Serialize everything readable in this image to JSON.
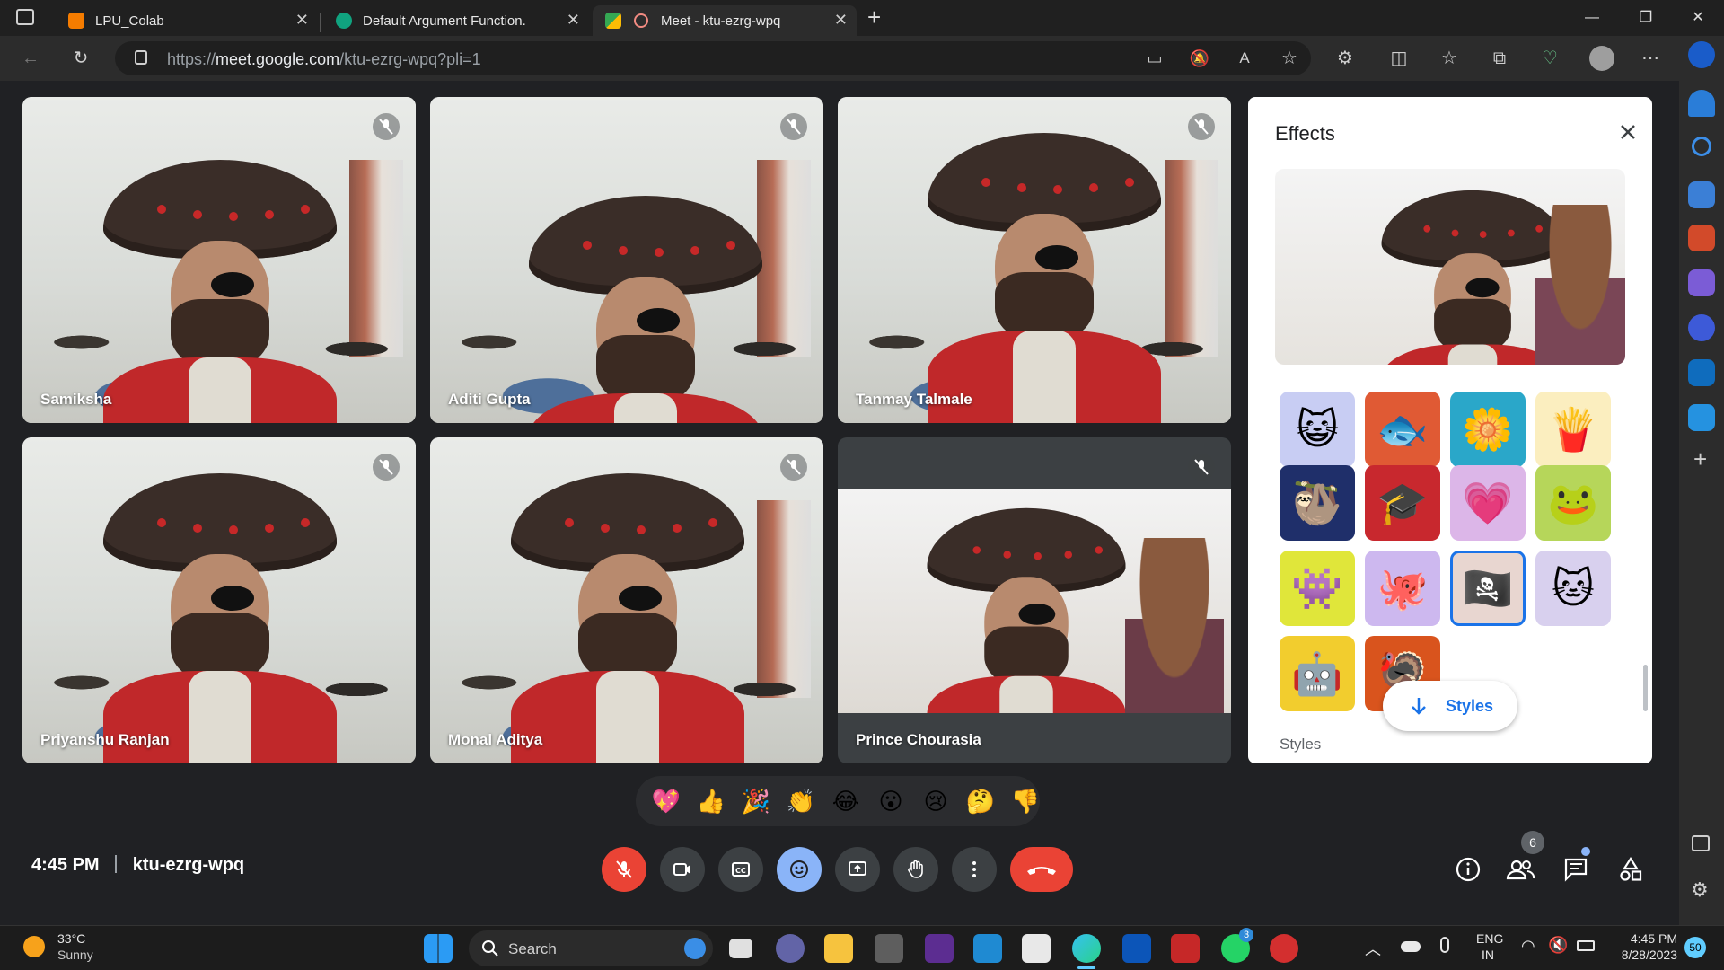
{
  "browser": {
    "tabs": [
      {
        "title": "LPU_Colab",
        "active": false
      },
      {
        "title": "Default Argument Function.",
        "active": false
      },
      {
        "title": "Meet - ktu-ezrg-wpq",
        "active": true
      }
    ],
    "url_prefix": "https://",
    "url_host": "meet.google.com",
    "url_path": "/ktu-ezrg-wpq?pli=1"
  },
  "participants": [
    {
      "name": "Samiksha"
    },
    {
      "name": "Aditi Gupta"
    },
    {
      "name": "Tanmay Talmale"
    },
    {
      "name": "Priyanshu Ranjan"
    },
    {
      "name": "Monal Aditya"
    },
    {
      "name": "Prince Chourasia"
    }
  ],
  "effects": {
    "title": "Effects",
    "styles_button": "Styles",
    "styles_heading": "Styles",
    "tiles": [
      {
        "icon": "glasses-cat-icon",
        "glyph": "😺"
      },
      {
        "icon": "blue-fish-icon",
        "glyph": "🐟"
      },
      {
        "icon": "daisy-flower-icon",
        "glyph": "🌼"
      },
      {
        "icon": "french-fries-icon",
        "glyph": "🍟"
      },
      {
        "icon": "sleeping-sloth-icon",
        "glyph": "🦥"
      },
      {
        "icon": "graduation-cap-icon",
        "glyph": "🎓"
      },
      {
        "icon": "rainbow-heart-icon",
        "glyph": "💗"
      },
      {
        "icon": "frog-icon",
        "glyph": "🐸"
      },
      {
        "icon": "purple-monster-icon",
        "glyph": "👾"
      },
      {
        "icon": "octopus-icon",
        "glyph": "🐙"
      },
      {
        "icon": "pirate-icon",
        "glyph": "🏴‍☠️"
      },
      {
        "icon": "white-cat-icon",
        "glyph": "🐱"
      },
      {
        "icon": "robot-icon",
        "glyph": "🤖"
      },
      {
        "icon": "turkey-icon",
        "glyph": "🦃"
      }
    ]
  },
  "reactions": [
    "💖",
    "👍",
    "🎉",
    "👏",
    "😂",
    "😮",
    "😢",
    "🤔",
    "👎"
  ],
  "meeting": {
    "time": "4:45 PM",
    "code": "ktu-ezrg-wpq"
  },
  "people_count": "6",
  "taskbar": {
    "weather_temp": "33°C",
    "weather_desc": "Sunny",
    "search_label": "Search",
    "whatsapp_badge": "3",
    "lang_primary": "ENG",
    "lang_region": "IN",
    "clock_time": "4:45 PM",
    "clock_date": "8/28/2023",
    "notification_count": "50"
  },
  "colors": {
    "end_call": "#ea4335",
    "accent_blue": "#8ab4f8",
    "meet_bg": "#202124"
  }
}
